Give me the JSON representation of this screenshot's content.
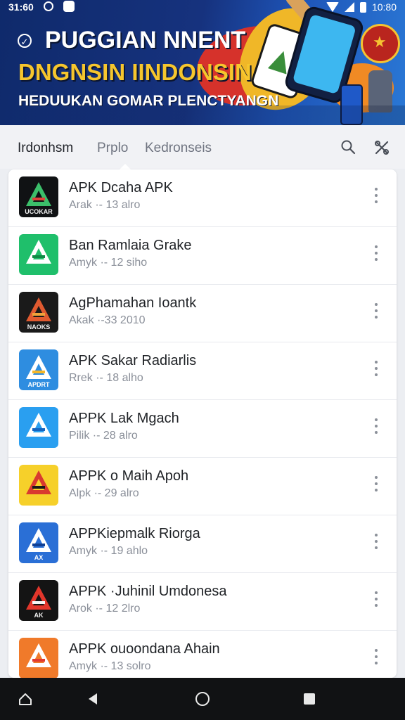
{
  "status_bar": {
    "time": "31:60",
    "clock": "10:80"
  },
  "banner": {
    "title": "PUGGIAN NNENT",
    "subtitle": "DNGNSIN IINDONSIN",
    "tagline": "HEDUUKAN GOMAR PLENCTYANGN"
  },
  "tabs": [
    {
      "label": "Irdonhsm",
      "active": true
    },
    {
      "label": "Prplo",
      "active": false
    },
    {
      "label": "Kedronseis",
      "active": false
    }
  ],
  "toolbar": {
    "search_icon": "search-icon",
    "tools_icon": "tools-icon"
  },
  "apps": [
    {
      "title": "APK Dcaha APK",
      "meta": "Arak  ·- 13 alro",
      "icon_label": "UCOKAR",
      "icon_bg": "#101214",
      "icon_fg": "#3bbf6a",
      "icon_accent": "#e0423a"
    },
    {
      "title": "Ban Ramlaia Grake",
      "meta": "Amyk  ·- 12 siho",
      "icon_label": "",
      "icon_bg": "#1fbf6b",
      "icon_fg": "#ffffff",
      "icon_accent": "#0f8a45"
    },
    {
      "title": "AgPhamahan Ioantk",
      "meta": "Akak  ·-33 2010",
      "icon_label": "NAOKS",
      "icon_bg": "#1a1a1a",
      "icon_fg": "#e05a30",
      "icon_accent": "#f0a33a"
    },
    {
      "title": "APK Sakar Radiarlis",
      "meta": "Rrek  ·- 18 alho",
      "icon_label": "APDRT",
      "icon_bg": "#2e8de0",
      "icon_fg": "#ffffff",
      "icon_accent": "#f4b627"
    },
    {
      "title": "APPK Lak Mgach",
      "meta": "Pilik  ·- 28 alro",
      "icon_label": "",
      "icon_bg": "#2a9ff0",
      "icon_fg": "#ffffff",
      "icon_accent": "#1565c0"
    },
    {
      "title": "APPK o Maih Apoh",
      "meta": "Alpk  ·- 29 alro",
      "icon_label": "",
      "icon_bg": "#f6d02a",
      "icon_fg": "#d93a2f",
      "icon_accent": "#1a1a1a"
    },
    {
      "title": "APPKiepmalk Riorga",
      "meta": "Amyk  ·- 19 ahlo",
      "icon_label": "AX",
      "icon_bg": "#2a6fd6",
      "icon_fg": "#ffffff",
      "icon_accent": "#0f3f94"
    },
    {
      "title": "APPK ·Juhinil Umdonesa",
      "meta": "Arok  ·- 12 2lro",
      "icon_label": "AK",
      "icon_bg": "#141414",
      "icon_fg": "#e2362b",
      "icon_accent": "#f4f4f4"
    },
    {
      "title": "APPK ouoondana Ahain",
      "meta": "Amyk  ·- 13 solro",
      "icon_label": "",
      "icon_bg": "#f07a2a",
      "icon_fg": "#ffffff",
      "icon_accent": "#e23a2f"
    }
  ],
  "nav_bar": {
    "home_icon": "home-icon",
    "back_icon": "back-icon",
    "circle_icon": "home-circle-icon",
    "recents_icon": "recents-icon"
  }
}
